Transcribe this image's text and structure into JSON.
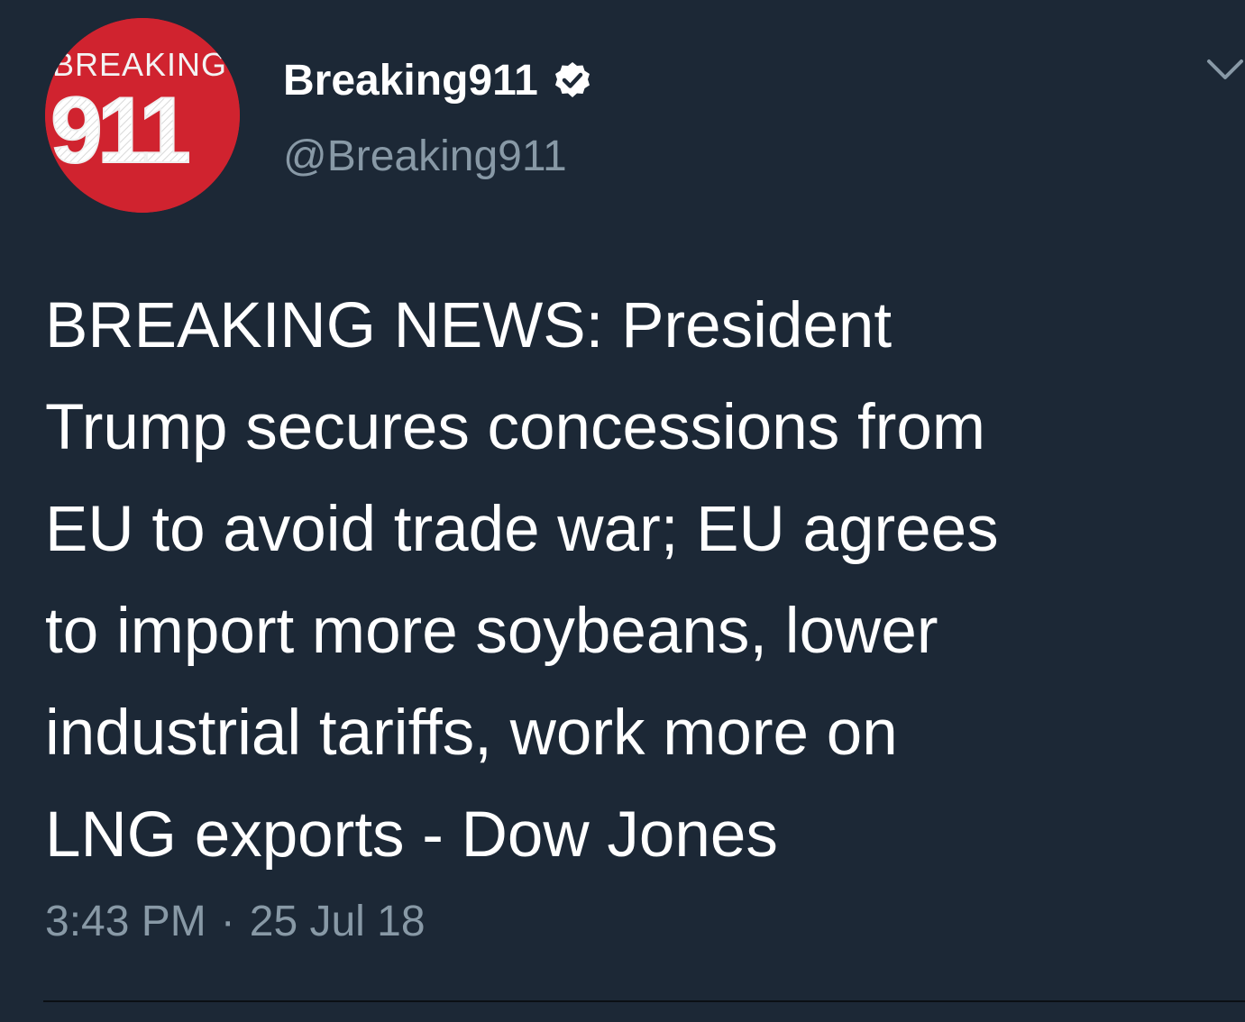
{
  "tweet": {
    "avatar": {
      "logo_word": "BREAKING",
      "logo_number": "911",
      "background_color": "#d0232f"
    },
    "author": {
      "display_name": "Breaking911",
      "handle": "@Breaking911",
      "verified": true
    },
    "text_lines": [
      "BREAKING NEWS: President",
      "Trump secures concessions from",
      "EU to avoid trade war; EU agrees",
      "to import more soybeans, lower",
      "industrial tariffs, work more on",
      "LNG exports - Dow Jones"
    ],
    "time": "3:43 PM",
    "separator": "·",
    "date": "25 Jul 18"
  },
  "icons": {
    "verified": "verified-badge-icon",
    "menu": "chevron-down-icon"
  },
  "colors": {
    "background": "#1c2836",
    "primary_text": "#ffffff",
    "secondary_text": "#8899a6"
  }
}
